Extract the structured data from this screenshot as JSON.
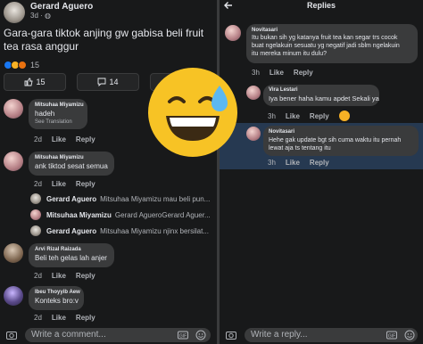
{
  "left": {
    "post": {
      "author": "Gerard Aguero",
      "meta": "3d · ",
      "text": "Gara-gara tiktok anjing gw gabisa beli fruit tea rasa anggur",
      "reaction_count": "15",
      "actions": [
        {
          "icon": "like-icon",
          "count": "15"
        },
        {
          "icon": "comment-icon",
          "count": "14"
        },
        {
          "icon": "share-icon",
          "count": ""
        }
      ]
    },
    "comments": [
      {
        "name": "Mitsuhaa Miyamizu",
        "text": "hadeh",
        "see": "See Translation",
        "time": "2d",
        "like": "Like",
        "reply": "Reply"
      },
      {
        "name": "Mitsuhaa Miyamizu",
        "text": "ank tiktod sesat semua",
        "time": "2d",
        "like": "Like",
        "reply": "Reply"
      },
      {
        "name": "Arvi Rizal Raizada",
        "text": "Beli teh gelas lah anjer",
        "time": "2d",
        "like": "Like",
        "reply": "Reply"
      },
      {
        "name": "Ibeu Thoyyib Aew",
        "text": "Konteks bro:v",
        "time": "2d",
        "like": "Like",
        "reply": "Reply"
      }
    ],
    "replies": [
      {
        "name": "Gerard Aguero",
        "text": "Mitsuhaa Miyamizu mau beli pun..."
      },
      {
        "name": "Mitsuhaa Miyamizu",
        "text": "Gerard AgueroGerard Aguer..."
      },
      {
        "name": "Gerard Aguero",
        "text": "Mitsuhaa Miyamizu njinx bersilat..."
      }
    ],
    "composer_placeholder": "Write a comment..."
  },
  "right": {
    "title": "Replies",
    "items": [
      {
        "name": "Novitasari",
        "lines": [
          "Itu bukan sih yg katanya fruit tea kan segar trs cocok",
          "buat ngelakuin sesuatu yg negatif jadi sblm ngelakuin",
          "itu mereka minum itu dulu?"
        ],
        "time": "3h",
        "like": "Like",
        "reply": "Reply"
      },
      {
        "name": "Vira Lestari",
        "lines": [
          "Iya bener haha kamu apdet Sekali ya"
        ],
        "time": "3h",
        "like": "Like",
        "reply": "Reply"
      },
      {
        "name": "Novitasari",
        "lines": [
          "Hehe gak update bgt sih cuma waktu itu pernah",
          "lewat aja ts tentang itu"
        ],
        "time": "3h",
        "like": "Like",
        "reply": "Reply"
      }
    ],
    "composer_placeholder": "Write a reply..."
  },
  "colors": {
    "background": "#18191a",
    "bubble": "#3a3b3c",
    "highlight": "#263951",
    "emoji_face": "#f7c325",
    "like_blue": "#1877f2"
  }
}
